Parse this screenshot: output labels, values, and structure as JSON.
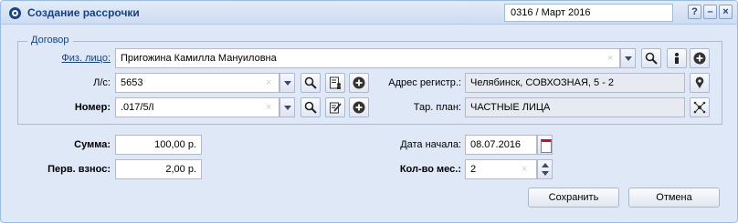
{
  "window": {
    "title": "Создание рассрочки",
    "period": "0316 / Март 2016",
    "buttons": {
      "help": "?",
      "minimize": "–",
      "close": "×"
    }
  },
  "contract": {
    "legend": "Договор",
    "person": {
      "label": "Физ. лицо:",
      "value": "Пригожина Камилла Мануиловна"
    },
    "account": {
      "label": "Л/с:",
      "value": "5653"
    },
    "number": {
      "label": "Номер:",
      "value": ".017/5/I"
    },
    "address": {
      "label": "Адрес регистр.:",
      "value": "Челябинск, СОВХОЗНАЯ, 5 - 2"
    },
    "tariff": {
      "label": "Тар. план:",
      "value": "ЧАСТНЫЕ ЛИЦА"
    }
  },
  "payment": {
    "sum": {
      "label": "Сумма:",
      "value": "100,00 р."
    },
    "first_payment": {
      "label": "Перв. взнос:",
      "value": "2,00 р."
    },
    "start_date": {
      "label": "Дата начала:",
      "value": "08.07.2016"
    },
    "months": {
      "label": "Кол-во мес.:",
      "value": "2"
    }
  },
  "actions": {
    "save": "Сохранить",
    "cancel": "Отмена"
  },
  "colors": {
    "title": "#15428b",
    "panel": "#dfe8f6",
    "border": "#99bbe8"
  },
  "clear_glyph": "×"
}
